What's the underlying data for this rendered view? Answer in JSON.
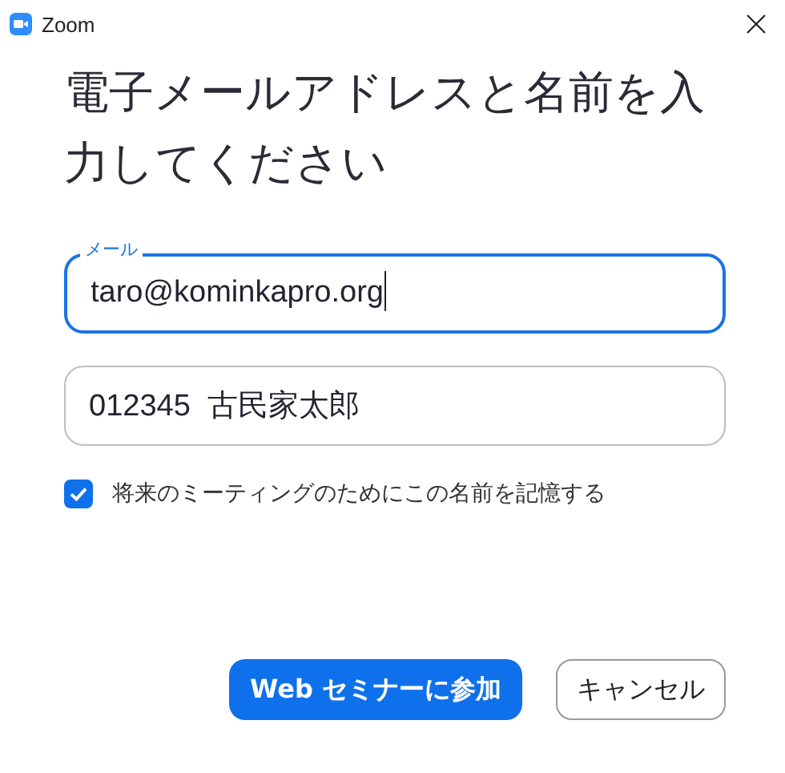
{
  "window": {
    "title": "Zoom"
  },
  "heading": "電子メールアドレスと名前を入力してください",
  "fields": [
    {
      "label": "メール",
      "value": "taro@kominkapro.org",
      "focused": true
    },
    {
      "value": "012345  古民家太郎",
      "focused": false
    }
  ],
  "remember": {
    "label": "将来のミーティングのためにこの名前を記憶する",
    "checked": true
  },
  "buttons": [
    {
      "label": "Web セミナーに参加",
      "kind": "primary"
    },
    {
      "label": "キャンセル",
      "kind": "secondary"
    }
  ]
}
